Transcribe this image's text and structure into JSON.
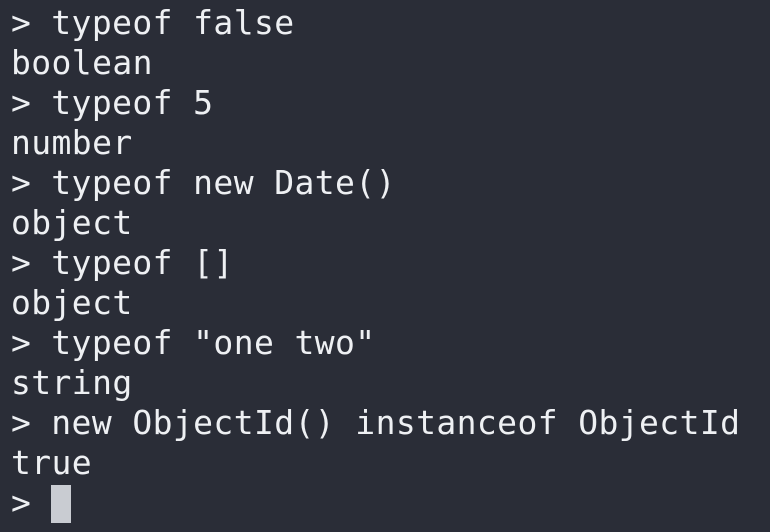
{
  "terminal": {
    "prompt_symbol": ">",
    "entries": [
      {
        "command": "typeof false",
        "output": "boolean"
      },
      {
        "command": "typeof 5",
        "output": "number"
      },
      {
        "command": "typeof new Date()",
        "output": "object"
      },
      {
        "command": "typeof []",
        "output": "object"
      },
      {
        "command": "typeof \"one two\"",
        "output": "string"
      },
      {
        "command": "new ObjectId() instanceof ObjectId",
        "output": "true"
      }
    ],
    "current_input": ""
  },
  "colors": {
    "background": "#2a2d37",
    "text": "#eef0f3",
    "cursor": "#c9ccd2"
  }
}
